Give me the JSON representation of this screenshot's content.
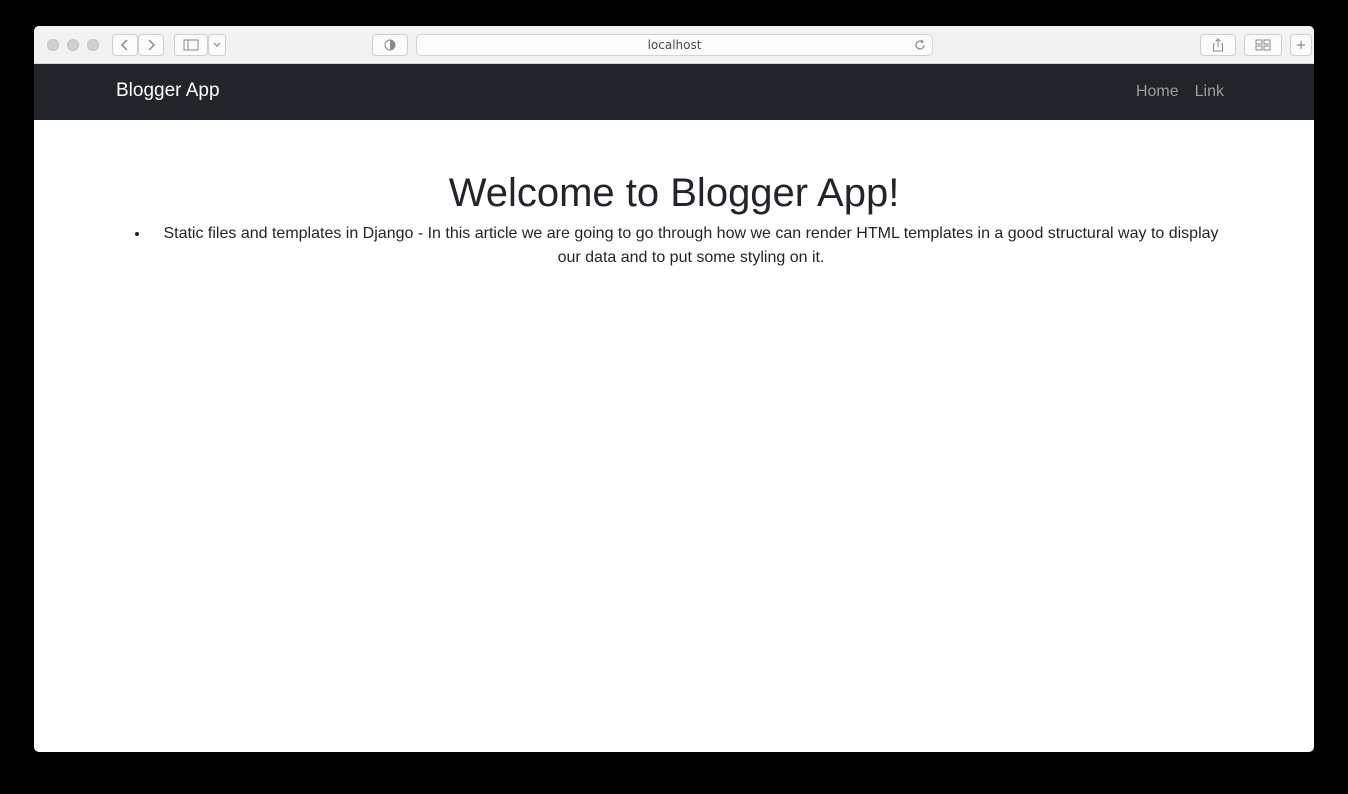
{
  "browser": {
    "url": "localhost"
  },
  "navbar": {
    "brand": "Blogger App",
    "links": [
      {
        "label": "Home"
      },
      {
        "label": "Link"
      }
    ],
    "colors": {
      "background": "#212529",
      "brand": "#ffffff",
      "link": "#9a9da0"
    }
  },
  "main": {
    "heading": "Welcome to Blogger App!",
    "posts": [
      {
        "text": "Static files and templates in Django - In this article we are going to go through how we can render HTML templates in a good structural way to display our data and to put some styling on it."
      }
    ]
  },
  "icons": {
    "back": "chevron-left-icon",
    "forward": "chevron-right-icon",
    "sidebar": "sidebar-icon",
    "privacy": "shield-icon",
    "reload": "reload-icon",
    "share": "share-icon",
    "tabs": "tabs-icon"
  }
}
